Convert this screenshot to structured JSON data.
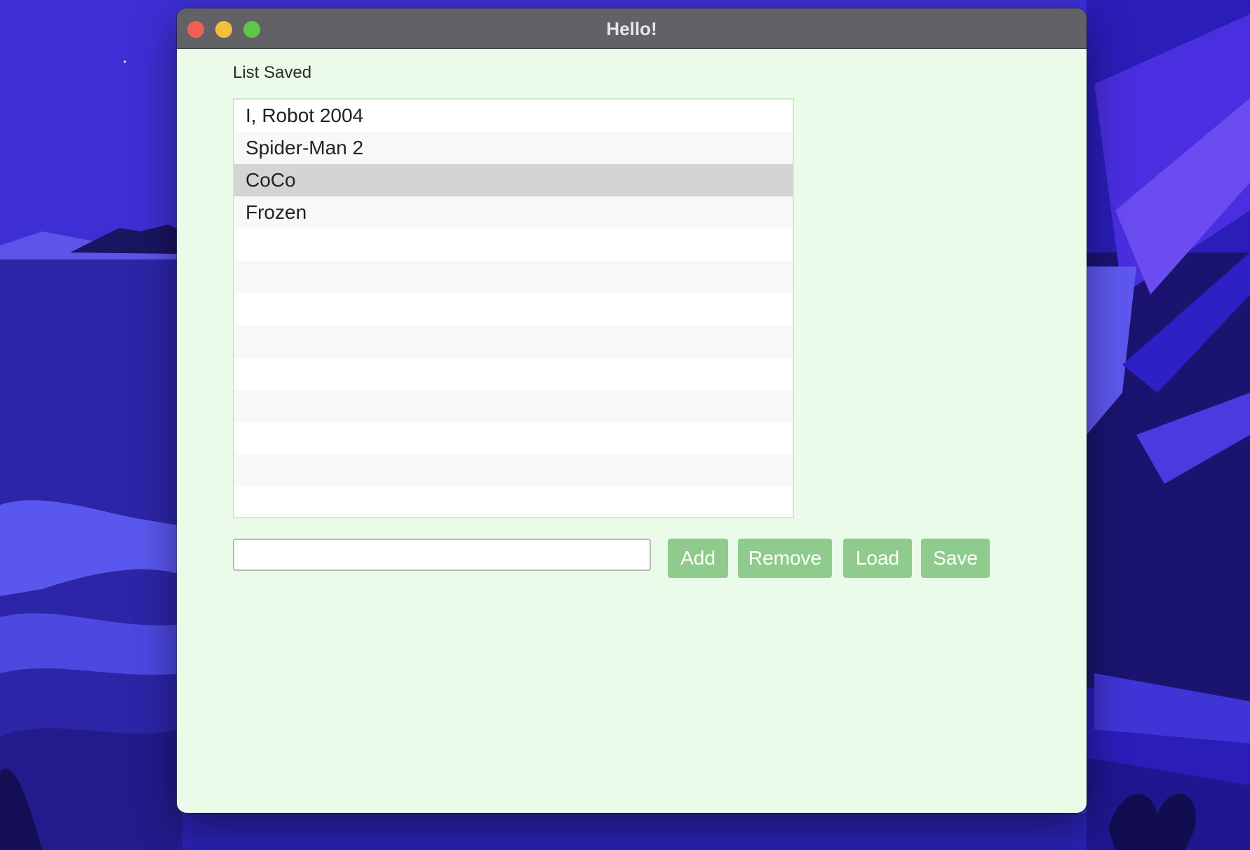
{
  "window": {
    "title": "Hello!"
  },
  "status_text": "List Saved",
  "list": {
    "items": [
      "I, Robot 2004",
      "Spider-Man 2",
      "CoCo",
      "Frozen",
      "",
      "",
      "",
      "",
      "",
      "",
      "",
      "",
      ""
    ],
    "selected_index": 2
  },
  "input": {
    "value": "",
    "placeholder": ""
  },
  "buttons": {
    "add": "Add",
    "remove": "Remove",
    "load": "Load",
    "save": "Save"
  },
  "colors": {
    "window_background": "#eafbea",
    "button_background": "#8fcb8c",
    "selection": "#d4d4d4",
    "titlebar": "#626166"
  }
}
